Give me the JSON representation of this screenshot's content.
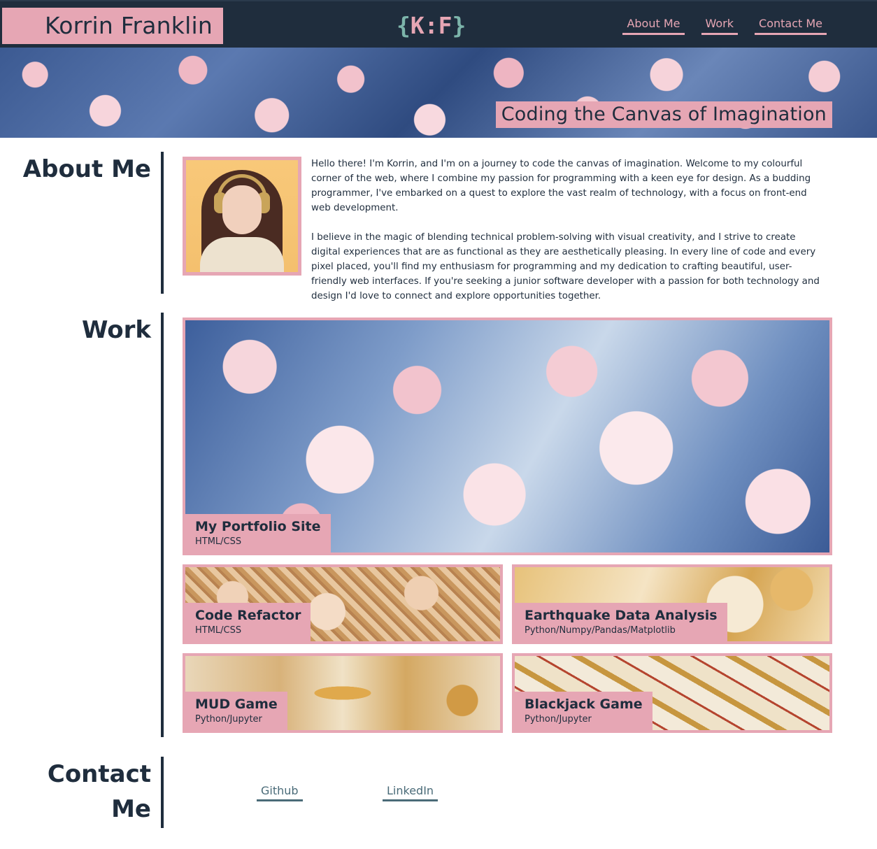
{
  "header": {
    "name": "Korrin Franklin",
    "logo": {
      "open": "{",
      "letters": "K:F",
      "close": "}"
    },
    "nav": [
      {
        "label": "About Me"
      },
      {
        "label": "Work"
      },
      {
        "label": "Contact Me"
      }
    ]
  },
  "banner": {
    "tagline": "Coding the Canvas of Imagination"
  },
  "about": {
    "title": "About Me",
    "paragraphs": [
      "Hello there! I'm Korrin, and I'm on a journey to code the canvas of imagination. Welcome to my colourful corner of the web, where I combine my passion for programming with a keen eye for design. As a budding programmer, I've embarked on a quest to explore the vast realm of technology, with a focus on front-end web development.",
      "I believe in the magic of blending technical problem-solving with visual creativity, and I strive to create digital experiences that are as functional as they are aesthetically pleasing. In every line of code and every pixel placed, you'll find my enthusiasm for programming and my dedication to crafting beautiful, user-friendly web interfaces. If you're seeking a junior software developer with a passion for both technology and design I'd love to connect and explore opportunities together."
    ]
  },
  "work": {
    "title": "Work",
    "projects": [
      {
        "title": "My Portfolio Site",
        "tech": "HTML/CSS"
      },
      {
        "title": "Code Refactor",
        "tech": "HTML/CSS"
      },
      {
        "title": "Earthquake Data Analysis",
        "tech": "Python/Numpy/Pandas/Matplotlib"
      },
      {
        "title": "MUD Game",
        "tech": "Python/Jupyter"
      },
      {
        "title": "Blackjack Game",
        "tech": "Python/Jupyter"
      }
    ]
  },
  "contact": {
    "title_line1": "Contact",
    "title_line2": "Me",
    "links": [
      {
        "label": "Github"
      },
      {
        "label": "LinkedIn"
      }
    ]
  },
  "colors": {
    "navy": "#1f2d3d",
    "pink": "#e6a6b4",
    "teal": "#7cb4aa",
    "link": "#4a6b78"
  }
}
